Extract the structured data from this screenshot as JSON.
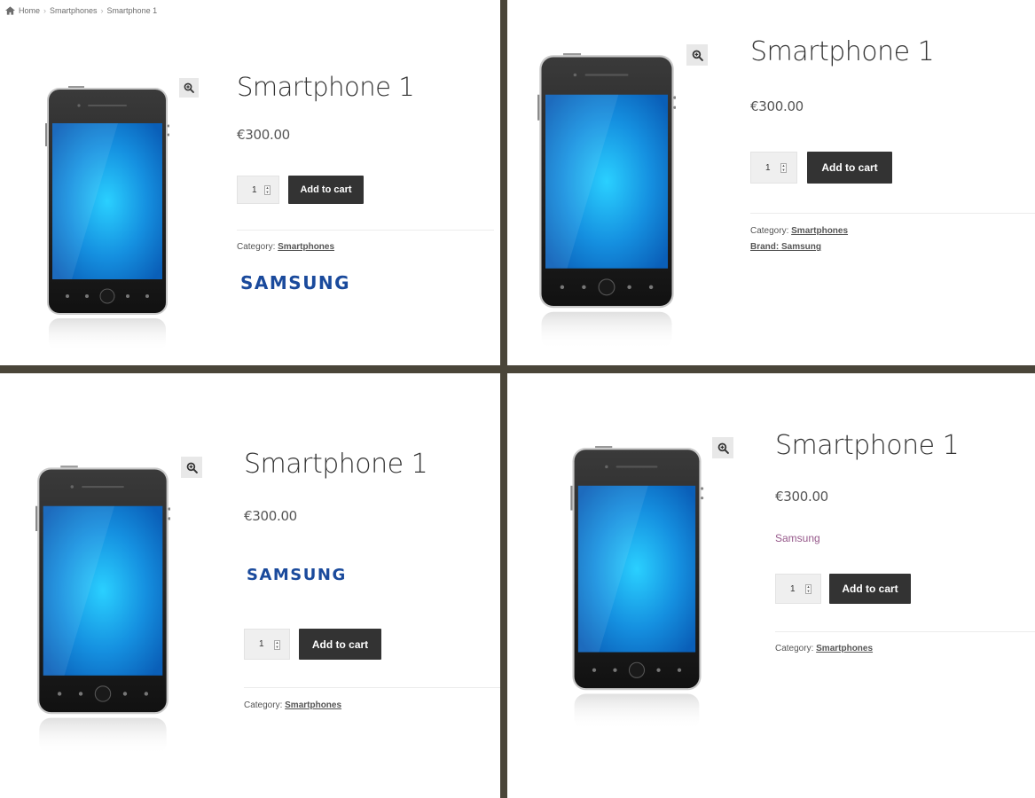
{
  "breadcrumb": {
    "home": "Home",
    "category": "Smartphones",
    "current": "Smartphone 1"
  },
  "product": {
    "title": "Smartphone 1",
    "price": "€300.00",
    "quantity": "1",
    "add_to_cart": "Add to cart",
    "category_label": "Category:",
    "category_value": "Smartphones",
    "brand_link": "Brand: Samsung",
    "brand_plain": "Samsung",
    "brand_logo_text": "SAMSUNG"
  },
  "colors": {
    "background_border": "#4a4539",
    "button_bg": "#333333",
    "brand_logo": "#1a4a9c",
    "brand_text": "#96588a",
    "screen_blue": "#1ea0f0"
  },
  "icons": {
    "zoom": "magnifier-plus-icon",
    "home": "home-icon"
  }
}
